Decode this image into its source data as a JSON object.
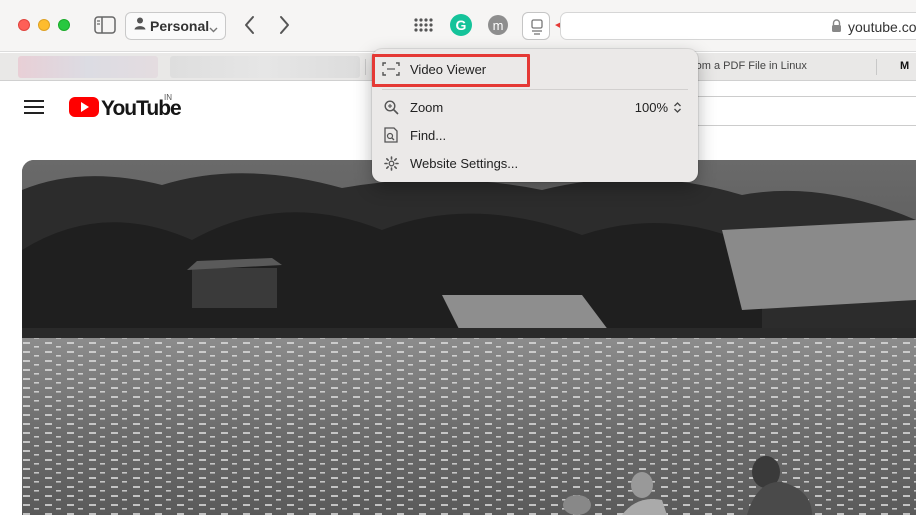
{
  "toolbar": {
    "profile_label": "Personal",
    "url": "youtube.co"
  },
  "tabs": {
    "tab_a": "rom a PDF File in Linux",
    "tab_b": "M"
  },
  "youtube": {
    "wordmark": "YouTube",
    "country": "IN"
  },
  "menu": {
    "video_viewer": "Video Viewer",
    "zoom_label": "Zoom",
    "zoom_value": "100%",
    "find": "Find...",
    "website_settings": "Website Settings..."
  },
  "colors": {
    "accent_red": "#e53935",
    "youtube_red": "#ff0000",
    "grammarly_green": "#15c39a"
  }
}
